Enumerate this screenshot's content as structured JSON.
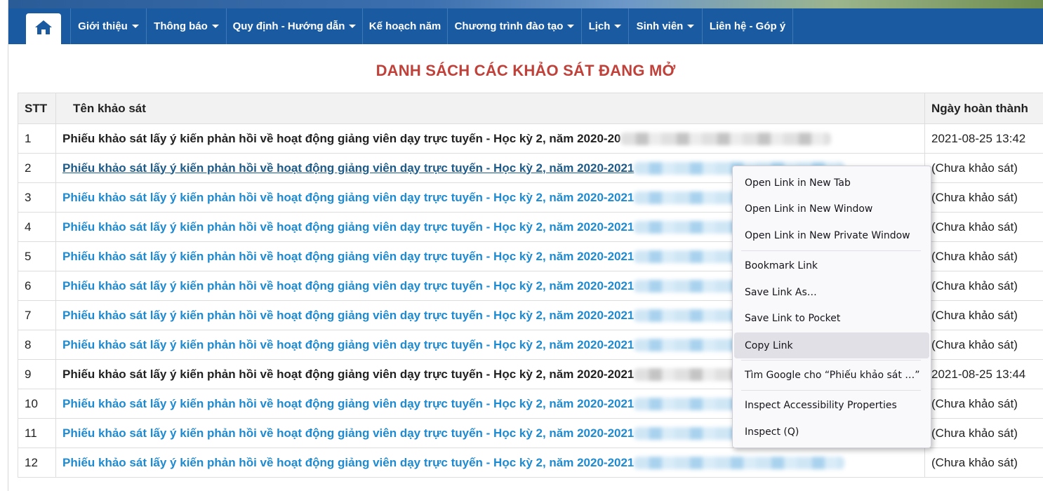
{
  "nav": {
    "home_icon": "home-icon",
    "items": [
      {
        "label": "Giới thiệu",
        "dropdown": true
      },
      {
        "label": "Thông báo",
        "dropdown": true
      },
      {
        "label": "Quy định - Hướng dẫn",
        "dropdown": true
      },
      {
        "label": "Kế hoạch năm",
        "dropdown": false
      },
      {
        "label": "Chương trình đào tạo",
        "dropdown": true
      },
      {
        "label": "Lịch",
        "dropdown": true
      },
      {
        "label": "Sinh viên",
        "dropdown": true
      },
      {
        "label": "Liên hệ - Góp ý",
        "dropdown": false
      }
    ]
  },
  "page": {
    "title": "DANH SÁCH CÁC KHẢO SÁT ĐANG MỞ"
  },
  "table": {
    "headers": {
      "stt": "STT",
      "name": "Tên khảo sát",
      "date": "Ngày hoàn thành"
    },
    "rows": [
      {
        "stt": "1",
        "name": "Phiếu khảo sát lấy ý kiến phản hồi về hoạt động giảng viên dạy trực tuyến - Học kỳ 2, năm 2020-20",
        "date": "2021-08-25 13:42"
      },
      {
        "stt": "2",
        "name": "Phiếu khảo sát lấy ý kiến phản hồi về hoạt động giảng viên dạy trực tuyến - Học kỳ 2, năm 2020-2021",
        "date": "(Chưa khảo sát)"
      },
      {
        "stt": "3",
        "name": "Phiếu khảo sát lấy ý kiến phản hồi về hoạt động giảng viên dạy trực tuyến - Học kỳ 2, năm 2020-2021",
        "date": "(Chưa khảo sát)"
      },
      {
        "stt": "4",
        "name": "Phiếu khảo sát lấy ý kiến phản hồi về hoạt động giảng viên dạy trực tuyến - Học kỳ 2, năm 2020-2021",
        "date": "(Chưa khảo sát)"
      },
      {
        "stt": "5",
        "name": "Phiếu khảo sát lấy ý kiến phản hồi về hoạt động giảng viên dạy trực tuyến - Học kỳ 2, năm 2020-2021",
        "date": "(Chưa khảo sát)"
      },
      {
        "stt": "6",
        "name": "Phiếu khảo sát lấy ý kiến phản hồi về hoạt động giảng viên dạy trực tuyến - Học kỳ 2, năm 2020-2021",
        "date": "(Chưa khảo sát)"
      },
      {
        "stt": "7",
        "name": "Phiếu khảo sát lấy ý kiến phản hồi về hoạt động giảng viên dạy trực tuyến - Học kỳ 2, năm 2020-2021",
        "date": "(Chưa khảo sát)"
      },
      {
        "stt": "8",
        "name": "Phiếu khảo sát lấy ý kiến phản hồi về hoạt động giảng viên dạy trực tuyến - Học kỳ 2, năm 2020-2021",
        "date": "(Chưa khảo sát)"
      },
      {
        "stt": "9",
        "name": "Phiếu khảo sát lấy ý kiến phản hồi về hoạt động giảng viên dạy trực tuyến - Học kỳ 2, năm 2020-2021",
        "date": "2021-08-25 13:44"
      },
      {
        "stt": "10",
        "name": "Phiếu khảo sát lấy ý kiến phản hồi về hoạt động giảng viên dạy trực tuyến - Học kỳ 2, năm 2020-2021",
        "date": "(Chưa khảo sát)"
      },
      {
        "stt": "11",
        "name": "Phiếu khảo sát lấy ý kiến phản hồi về hoạt động giảng viên dạy trực tuyến - Học kỳ 2, năm 2020-2021",
        "date": "(Chưa khảo sát)"
      },
      {
        "stt": "12",
        "name": "Phiếu khảo sát lấy ý kiến phản hồi về hoạt động giảng viên dạy trực tuyến - Học kỳ 2, năm 2020-2021",
        "date": "(Chưa khảo sát)"
      }
    ]
  },
  "context_menu": {
    "items": [
      {
        "label": "Open Link in New Tab"
      },
      {
        "label": "Open Link in New Window"
      },
      {
        "label": "Open Link in New Private Window"
      },
      {
        "label": "Bookmark Link"
      },
      {
        "label": "Save Link As…"
      },
      {
        "label": "Save Link to Pocket"
      },
      {
        "label": "Copy Link"
      },
      {
        "label": "Tìm Google cho “Phiếu khảo sát …”"
      },
      {
        "label": "Inspect Accessibility Properties"
      },
      {
        "label": "Inspect (Q)"
      }
    ]
  },
  "colors": {
    "nav_bg": "#1a5aa0",
    "title": "#c0413a",
    "link": "#1d8ad1",
    "link_hover": "#1e5b88"
  }
}
